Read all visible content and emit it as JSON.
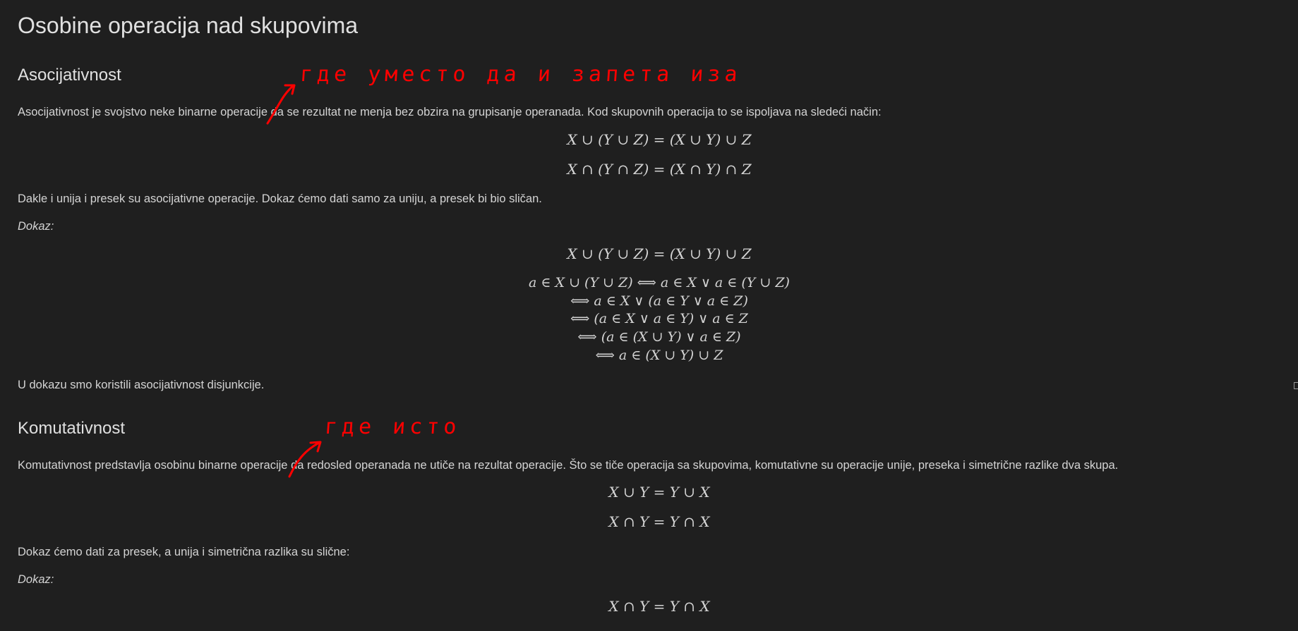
{
  "title": "Osobine operacija nad skupovima",
  "sections": {
    "asoc": {
      "heading": "Asocijativnost",
      "intro": "Asocijativnost je svojstvo neke binarne operacije da se rezultat ne menja bez obzira na grupisanje operanada. Kod skupovnih operacija to se ispoljava na sledeći način:",
      "eq1": "X ∪ (Y ∪ Z) = (X ∪ Y) ∪ Z",
      "eq2": "X ∩ (Y ∩ Z) = (X ∩ Y) ∩ Z",
      "remark": "Dakle i unija i presek su asocijativne operacije. Dokaz ćemo dati samo za uniju, a presek bi bio sličan.",
      "proof_label": "Dokaz:",
      "proof_eq": "X ∪ (Y ∪ Z) = (X ∪ Y) ∪ Z",
      "steps": [
        "a ∈ X ∪ (Y ∪ Z)  ⟺  a ∈ X ∨ a ∈ (Y ∪ Z)",
        "⟺  a ∈ X ∨ (a ∈ Y ∨ a ∈ Z)",
        "⟺  (a ∈ X ∨ a ∈ Y) ∨ a ∈ Z",
        "⟺  (a ∈ (X ∪ Y) ∨ a ∈ Z)",
        "⟺  a ∈ (X ∪ Y) ∪ Z"
      ],
      "conclusion": "U dokazu smo koristili asocijativnost disjunkcije."
    },
    "kom": {
      "heading": "Komutativnost",
      "intro": "Komutativnost predstavlja osobinu binarne operacije da redosled operanada ne utiče na rezultat operacije. Što se tiče operacija sa skupovima, komutativne su operacije unije, preseka i simetrične razlike dva skupa.",
      "eq1": "X ∪ Y = Y ∪ X",
      "eq2": "X ∩ Y = Y ∩ X",
      "remark": "Dokaz ćemo dati za presek, a unija i simetrična razlika su slične:",
      "proof_label": "Dokaz:",
      "proof_eq": "X ∩ Y = Y ∩ X"
    }
  },
  "annotations": {
    "note1": "где уместо да   и запета иза",
    "note2": "где  исто"
  },
  "colors": {
    "background": "#1f1f1f",
    "text": "#d4d4d4",
    "annotation": "#ff0000"
  }
}
